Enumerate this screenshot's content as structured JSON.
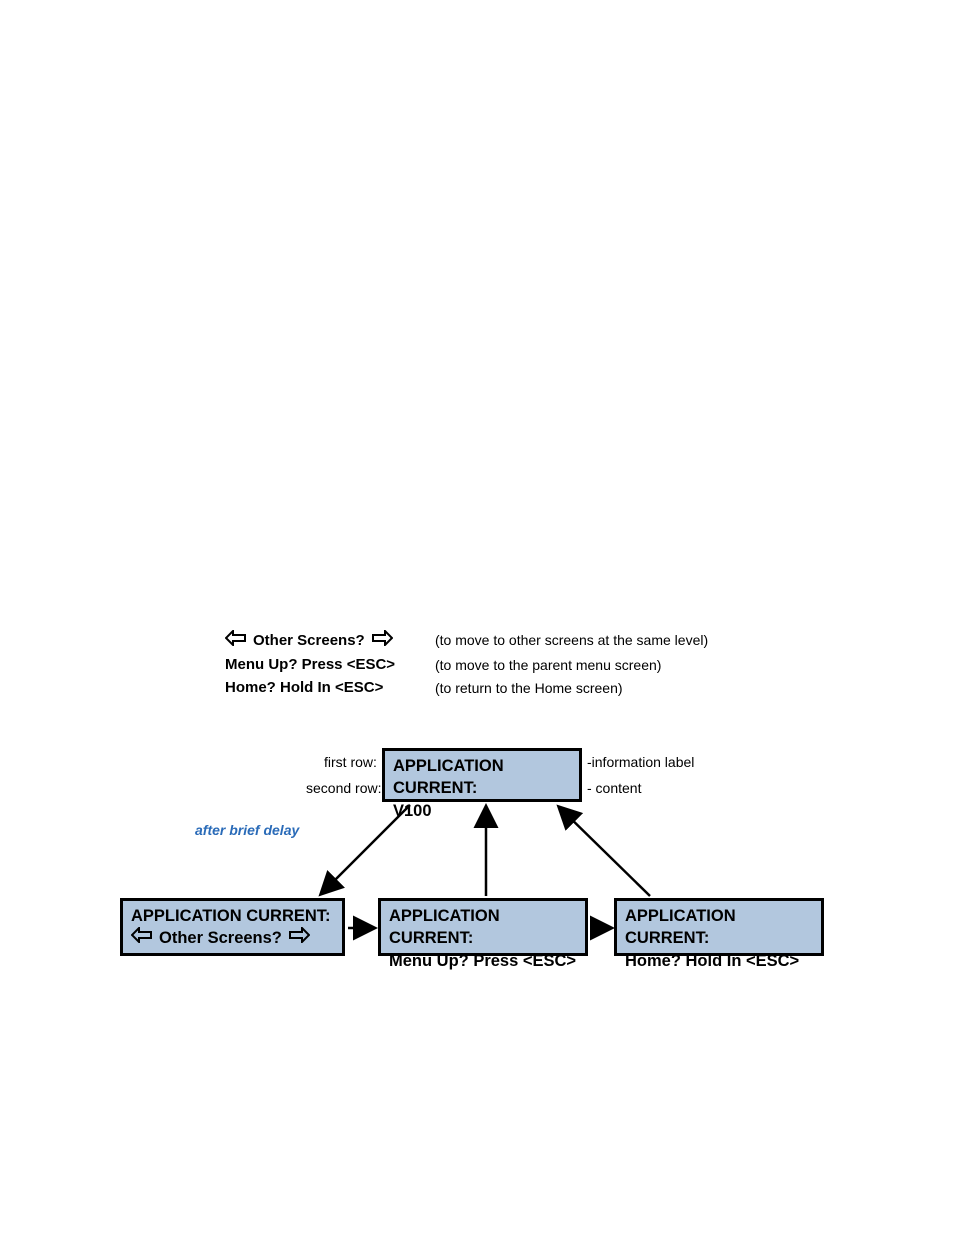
{
  "legend": {
    "row1": {
      "label": "Other Screens?",
      "desc": "(to move to other screens at the same level)"
    },
    "row2": {
      "label": "Menu Up? Press <ESC>",
      "desc": "(to move to the parent menu screen)"
    },
    "row3": {
      "label": "Home? Hold In <ESC>",
      "desc": "(to return to the Home screen)"
    }
  },
  "delay_text": "after brief delay",
  "top_box": {
    "row1": "APPLICATION CURRENT:",
    "row2": "V100"
  },
  "annotations": {
    "first_row": "first row:",
    "second_row": "second row:",
    "info_label": "-information label",
    "content": "- content"
  },
  "bottom_boxes": {
    "left": {
      "row1": "APPLICATION CURRENT:",
      "row2": "Other Screens?"
    },
    "center": {
      "row1": "APPLICATION CURRENT:",
      "row2": "Menu Up? Press <ESC>"
    },
    "right": {
      "row1": "APPLICATION CURRENT:",
      "row2": "Home? Hold In <ESC>"
    }
  }
}
